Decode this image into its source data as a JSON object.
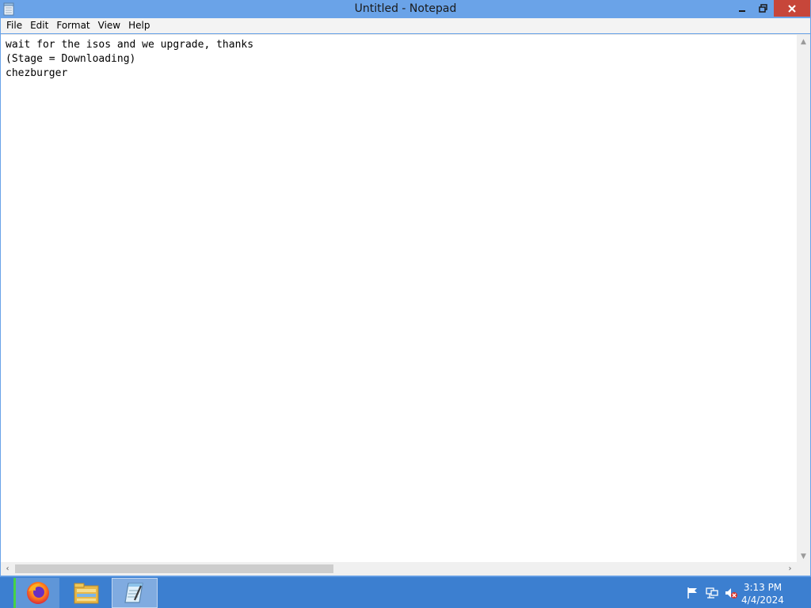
{
  "window": {
    "title": "Untitled - Notepad"
  },
  "menu": {
    "items": [
      "File",
      "Edit",
      "Format",
      "View",
      "Help"
    ]
  },
  "editor": {
    "content": "wait for the isos and we upgrade, thanks\n(Stage = Downloading)\nchezburger"
  },
  "scrollbar": {
    "left_arrow": "‹",
    "right_arrow": "›",
    "up_arrow": "▲",
    "down_arrow": "▼"
  },
  "taskbar": {
    "apps": [
      {
        "name": "firefox-icon"
      },
      {
        "name": "file-explorer-icon"
      },
      {
        "name": "notepad-icon"
      }
    ]
  },
  "clock": {
    "time": "3:13 PM",
    "date": "4/4/2024"
  },
  "colors": {
    "titlebar": "#6aa3e8",
    "close_button": "#c7463a",
    "taskbar": "#3c7fd0"
  }
}
